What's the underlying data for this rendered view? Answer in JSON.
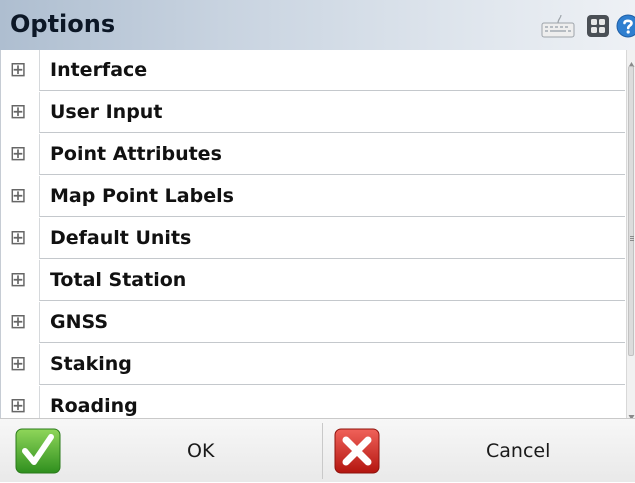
{
  "window": {
    "title": "Options"
  },
  "title_icons": [
    "keyboard-icon",
    "grid-icon",
    "help-icon"
  ],
  "sections": [
    {
      "label": "Interface",
      "expander": "⊞"
    },
    {
      "label": "User Input",
      "expander": "⊞"
    },
    {
      "label": "Point Attributes",
      "expander": "⊞"
    },
    {
      "label": "Map Point Labels",
      "expander": "⊞"
    },
    {
      "label": "Default Units",
      "expander": "⊞"
    },
    {
      "label": "Total Station",
      "expander": "⊞"
    },
    {
      "label": "GNSS",
      "expander": "⊞"
    },
    {
      "label": "Staking",
      "expander": "⊞"
    },
    {
      "label": "Roading",
      "expander": "⊞"
    }
  ],
  "footer": {
    "ok_label": "OK",
    "cancel_label": "Cancel"
  },
  "colors": {
    "ok_green": "#3fa52a",
    "cancel_red": "#d6261e",
    "help_blue": "#2f7fd0"
  }
}
